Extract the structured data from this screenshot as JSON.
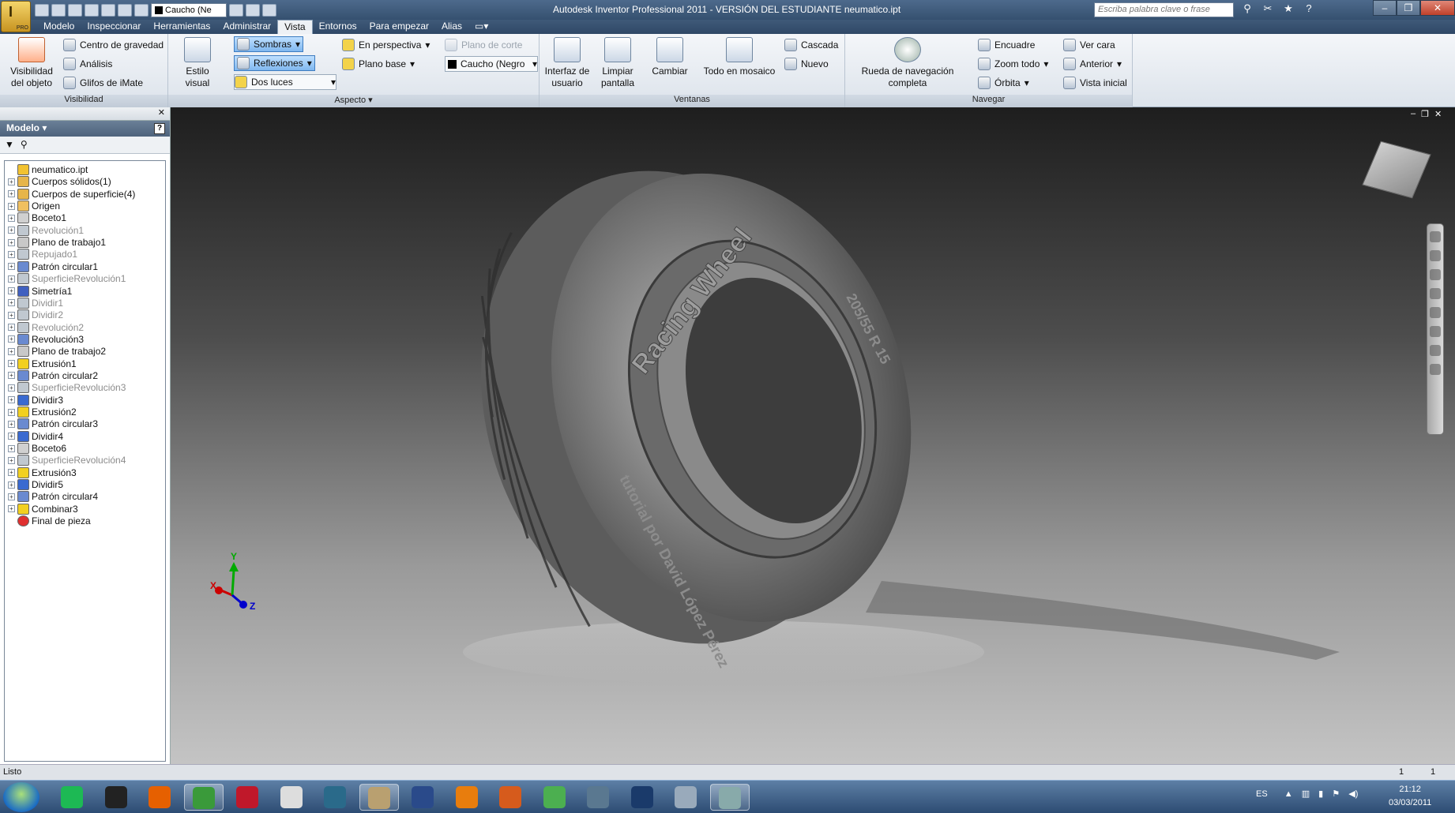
{
  "window": {
    "title": "Autodesk Inventor Professional 2011 - VERSIÓN DEL ESTUDIANTE   neumatico.ipt"
  },
  "app_button": {
    "badge": "PRO"
  },
  "quick_access": {
    "material": "Caucho (Ne"
  },
  "search": {
    "placeholder": "Escriba palabra clave o frase"
  },
  "menu_tabs": [
    "Modelo",
    "Inspeccionar",
    "Herramientas",
    "Administrar",
    "Vista",
    "Entornos",
    "Para empezar",
    "Alias"
  ],
  "ribbon": {
    "visibilidad": {
      "title": "Visibilidad",
      "big": "Visibilidad del objeto",
      "items": [
        "Centro de gravedad",
        "Análisis",
        "Glifos de iMate"
      ]
    },
    "aspecto": {
      "title": "Aspecto",
      "big": "Estilo visual",
      "sombras": "Sombras",
      "reflexiones": "Reflexiones",
      "luces": "Dos luces",
      "perspectiva": "En perspectiva",
      "plano_base": "Plano base",
      "plano_corte": "Plano de corte",
      "material": "Caucho (Negro"
    },
    "ventanas": {
      "title": "Ventanas",
      "interfaz": "Interfaz de usuario",
      "limpiar": "Limpiar pantalla",
      "cambiar": "Cambiar",
      "mosaico": "Todo en mosaico",
      "cascada": "Cascada",
      "nuevo": "Nuevo"
    },
    "navegar": {
      "title": "Navegar",
      "rueda": "Rueda de navegación completa",
      "encuadre": "Encuadre",
      "zoom": "Zoom todo",
      "orbita": "Órbita",
      "ver_cara": "Ver cara",
      "anterior": "Anterior",
      "vista_inicial": "Vista inicial"
    }
  },
  "browser": {
    "title": "Modelo",
    "help": "?",
    "items": [
      {
        "label": "neumatico.ipt",
        "dim": false,
        "root": true,
        "color": "#f2c230"
      },
      {
        "label": "Cuerpos sólidos(1)",
        "dim": false,
        "color": "#e6b54a"
      },
      {
        "label": "Cuerpos de superficie(4)",
        "dim": false,
        "color": "#e6b54a"
      },
      {
        "label": "Origen",
        "dim": false,
        "color": "#f0c060"
      },
      {
        "label": "Boceto1",
        "dim": false,
        "color": "#d0d0d0"
      },
      {
        "label": "Revolución1",
        "dim": true,
        "color": "#c0c8d0"
      },
      {
        "label": "Plano de trabajo1",
        "dim": false,
        "color": "#c8c8c8"
      },
      {
        "label": "Repujado1",
        "dim": true,
        "color": "#c0c8d0"
      },
      {
        "label": "Patrón circular1",
        "dim": false,
        "color": "#6a8ad0"
      },
      {
        "label": "SuperficieRevolución1",
        "dim": true,
        "color": "#c0c8d0"
      },
      {
        "label": "Simetría1",
        "dim": false,
        "color": "#4060c0"
      },
      {
        "label": "Dividir1",
        "dim": true,
        "color": "#c0c8d0"
      },
      {
        "label": "Dividir2",
        "dim": true,
        "color": "#c0c8d0"
      },
      {
        "label": "Revolución2",
        "dim": true,
        "color": "#c0c8d0"
      },
      {
        "label": "Revolución3",
        "dim": false,
        "color": "#6a8ad0"
      },
      {
        "label": "Plano de trabajo2",
        "dim": false,
        "color": "#c8c8c8"
      },
      {
        "label": "Extrusión1",
        "dim": false,
        "color": "#f2d020"
      },
      {
        "label": "Patrón circular2",
        "dim": false,
        "color": "#6a8ad0"
      },
      {
        "label": "SuperficieRevolución3",
        "dim": true,
        "color": "#c0c8d0"
      },
      {
        "label": "Dividir3",
        "dim": false,
        "color": "#3a6ad0"
      },
      {
        "label": "Extrusión2",
        "dim": false,
        "color": "#f2d020"
      },
      {
        "label": "Patrón circular3",
        "dim": false,
        "color": "#6a8ad0"
      },
      {
        "label": "Dividir4",
        "dim": false,
        "color": "#3a6ad0"
      },
      {
        "label": "Boceto6",
        "dim": false,
        "color": "#d0d0d0"
      },
      {
        "label": "SuperficieRevolución4",
        "dim": true,
        "color": "#c0c8d0"
      },
      {
        "label": "Extrusión3",
        "dim": false,
        "color": "#f2d020"
      },
      {
        "label": "Dividir5",
        "dim": false,
        "color": "#3a6ad0"
      },
      {
        "label": "Patrón circular4",
        "dim": false,
        "color": "#6a8ad0"
      },
      {
        "label": "Combinar3",
        "dim": false,
        "color": "#f2d020"
      },
      {
        "label": "Final de pieza",
        "dim": false,
        "end": true,
        "color": "#e03030"
      }
    ]
  },
  "tire_text": {
    "brand": "Racing Wheel",
    "size": "205/55 R 15",
    "author": "tutorial por David López Pérez"
  },
  "status": {
    "left": "Listo",
    "page": "1",
    "total": "1"
  },
  "taskbar": {
    "apps": [
      "Spotify",
      "Opera",
      "Firefox",
      "Windows",
      "i2 PRO",
      "Document",
      "Max",
      "Inventor",
      "Photoshop CS",
      "Blender",
      "Matlab",
      "Chrome",
      "M",
      "Ps",
      "Control",
      "Paint"
    ],
    "lang": "ES",
    "time": "21:12",
    "date": "03/03/2011"
  }
}
